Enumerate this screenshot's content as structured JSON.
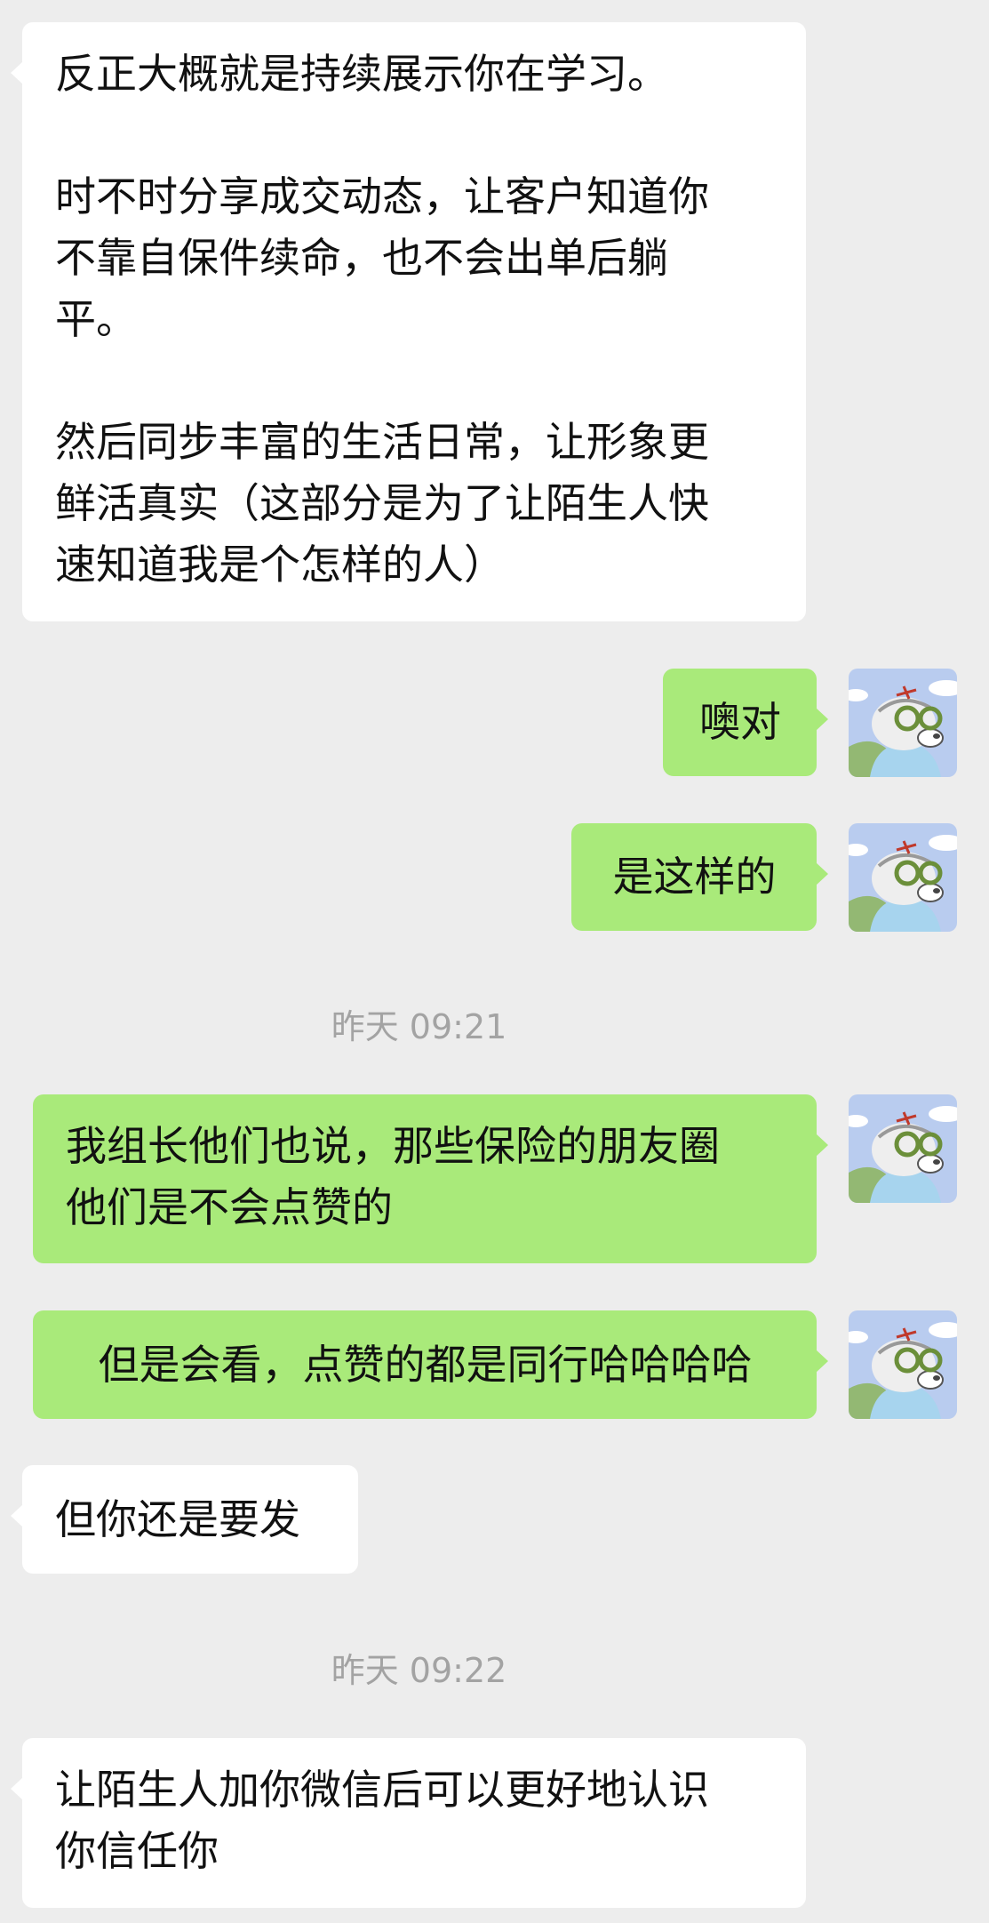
{
  "messages": [
    {
      "side": "left",
      "text": "反正大概就是持续展示你在学习。\n\n时不时分享成交动态，让客户知道你\n不靠自保件续命，也不会出单后躺\n平。\n\n然后同步丰富的生活日常，让形象更\n鲜活真实（这部分是为了让陌生人快\n速知道我是个怎样的人）"
    },
    {
      "side": "right",
      "text": "噢对"
    },
    {
      "side": "right",
      "text": "是这样的"
    },
    {
      "side": "right",
      "text": "我组长他们也说，那些保险的朋友圈\n他们是不会点赞的"
    },
    {
      "side": "right",
      "text": "但是会看，点赞的都是同行哈哈哈哈"
    },
    {
      "side": "left",
      "text": "但你还是要发"
    },
    {
      "side": "left",
      "text": "让陌生人加你微信后可以更好地认识\n你信任你"
    }
  ],
  "timestamps": [
    "昨天 09:21",
    "昨天 09:22"
  ],
  "avatar": {
    "icon": "cartoon-avatar-icon",
    "sky_color": "#b9ccef",
    "shirt_color": "#a7d4ee"
  },
  "colors": {
    "background": "#ededed",
    "incoming_bubble": "#ffffff",
    "outgoing_bubble": "#a9ea7a",
    "timestamp_text": "#a3a3a3"
  }
}
